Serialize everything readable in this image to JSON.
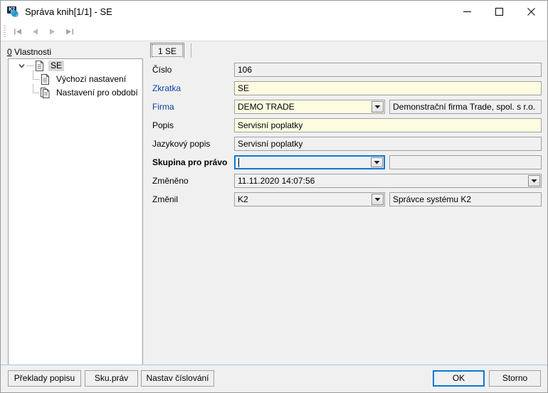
{
  "window": {
    "title": "Správa knih[1/1] - SE",
    "icon": "k2-app-icon",
    "minimize_label": "minimize-icon",
    "maximize_label": "maximize-icon",
    "close_label": "close-icon"
  },
  "nav": {
    "first_label": "first-record-icon",
    "prev_label": "previous-record-icon",
    "next_label": "next-record-icon",
    "last_label": "last-record-icon"
  },
  "tree": {
    "header_accesskey": "0",
    "header_label": " Vlastnosti",
    "nodes": [
      {
        "label": "SE",
        "selected": true,
        "level": 0
      },
      {
        "label": "Výchozí nastavení",
        "selected": false,
        "level": 1
      },
      {
        "label": "Nastavení pro období",
        "selected": false,
        "level": 1
      }
    ]
  },
  "tabs": [
    {
      "label": "1 SE",
      "active": true
    }
  ],
  "form": {
    "rows": {
      "cislo": {
        "label": "Číslo",
        "value": "106"
      },
      "zkratka": {
        "label": "Zkratka",
        "value": "SE"
      },
      "firma": {
        "label": "Firma",
        "value": "DEMO TRADE",
        "side_value": "Demonstrační firma Trade, spol. s r.o."
      },
      "popis": {
        "label": "Popis",
        "value": "Servisní poplatky"
      },
      "jazykovy_popis": {
        "label": "Jazykový popis",
        "value": "Servisní poplatky"
      },
      "skupina": {
        "label": "Skupina pro právo",
        "value": "",
        "side_value": ""
      },
      "zmeneno": {
        "label": "Změněno",
        "value": "11.11.2020 14:07:56"
      },
      "zmenil": {
        "label": "Změnil",
        "value": "K2",
        "side_value": "Správce systému K2"
      }
    }
  },
  "footer": {
    "preklady_label": "Překlady popisu",
    "skuprav_label": "Sku.práv",
    "cislovani_label": "Nastav číslování",
    "ok_label": "OK",
    "storno_label": "Storno"
  },
  "colors": {
    "accent": "#0a79d6",
    "link_label": "#0c41a8",
    "editable_field": "#fdfce1",
    "window_bg": "#f0f0f0"
  }
}
